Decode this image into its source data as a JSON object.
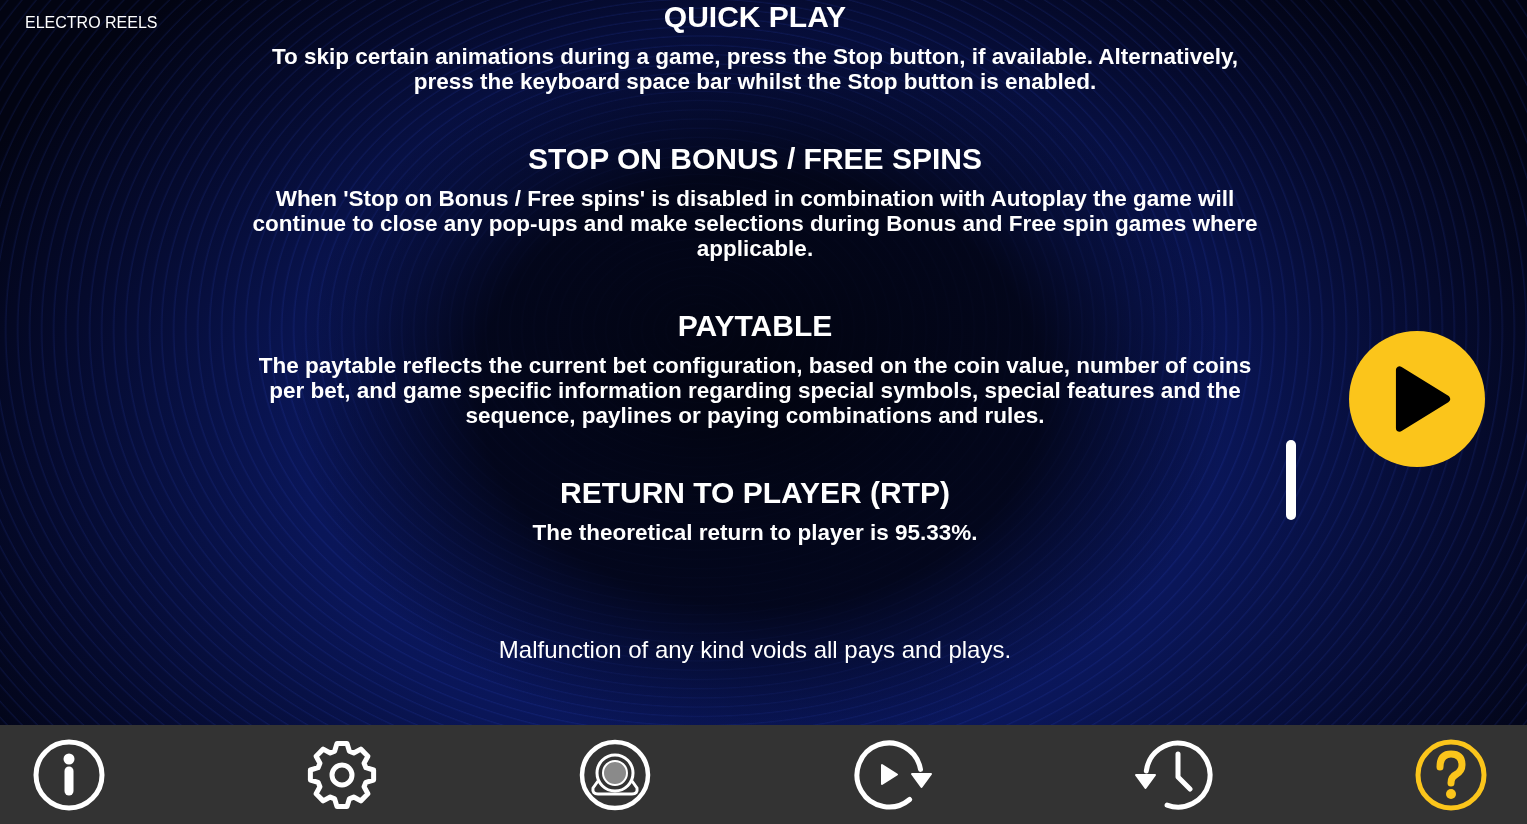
{
  "game_title": "ELECTRO REELS",
  "sections": [
    {
      "heading": "QUICK PLAY",
      "text": "To skip certain animations during a game, press the Stop button, if available. Alternatively, press the keyboard space bar whilst the Stop button is enabled."
    },
    {
      "heading": "STOP ON BONUS / FREE SPINS",
      "text": "When 'Stop on Bonus / Free spins' is disabled in combination with Autoplay the game will continue to close any pop-ups and make selections during Bonus and Free spin games where applicable."
    },
    {
      "heading": "PAYTABLE",
      "text": "The paytable reflects the current bet configuration, based on the coin value, number of coins per bet, and game specific information regarding special symbols, special features and the sequence, paylines or paying combinations and rules."
    },
    {
      "heading": "RETURN TO PLAYER (RTP)",
      "text": "The theoretical return to player is 95.33%."
    }
  ],
  "disclaimer": "Malfunction of any kind voids all pays and plays.",
  "toolbar": [
    {
      "selected": false
    },
    {
      "selected": false
    },
    {
      "selected": false
    },
    {
      "selected": false
    },
    {
      "selected": false
    },
    {
      "selected": true
    }
  ]
}
